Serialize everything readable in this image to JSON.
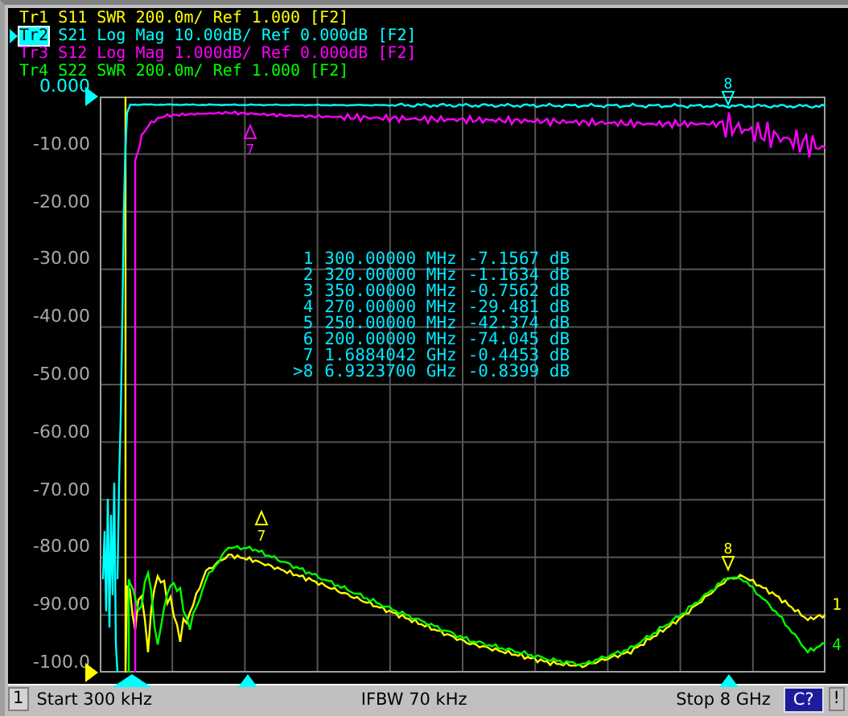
{
  "traces": [
    {
      "name": "Tr1",
      "param": "S11",
      "format": "SWR",
      "scale": "200.0m/",
      "ref": "Ref 1.000",
      "channel": "[F2]",
      "color": "#ffff00",
      "selected": false,
      "end_tag": "1"
    },
    {
      "name": "Tr2",
      "param": "S21",
      "format": "Log Mag",
      "scale": "10.00dB/",
      "ref": "Ref 0.000dB",
      "channel": "[F2]",
      "color": "#00ffff",
      "selected": true
    },
    {
      "name": "Tr3",
      "param": "S12",
      "format": "Log Mag",
      "scale": "1.000dB/",
      "ref": "Ref 0.000dB",
      "channel": "[F2]",
      "color": "#ff00ff",
      "selected": false
    },
    {
      "name": "Tr4",
      "param": "S22",
      "format": "SWR",
      "scale": "200.0m/",
      "ref": "Ref 1.000",
      "channel": "[F2]",
      "color": "#00ff00",
      "selected": false,
      "end_tag": "4"
    }
  ],
  "y_axis_labels": [
    {
      "text": "0.000",
      "reference": true
    },
    {
      "text": "-10.00",
      "reference": false
    },
    {
      "text": "-20.00",
      "reference": false
    },
    {
      "text": "-30.00",
      "reference": false
    },
    {
      "text": "-40.00",
      "reference": false
    },
    {
      "text": "-50.00",
      "reference": false
    },
    {
      "text": "-60.00",
      "reference": false
    },
    {
      "text": "-70.00",
      "reference": false
    },
    {
      "text": "-80.00",
      "reference": false
    },
    {
      "text": "-90.00",
      "reference": false
    },
    {
      "text": "-100.0",
      "reference": false
    }
  ],
  "flags": [
    {
      "label": "8",
      "color": "#00ffff"
    },
    {
      "label": "7",
      "color": "#ff00ff"
    },
    {
      "label": "7",
      "color": "#ffff00"
    },
    {
      "label": "8",
      "color": "#ffff00"
    }
  ],
  "markers": [
    {
      "label": "1",
      "stimulus": "300.00000 MHz",
      "response": "-7.1567 dB"
    },
    {
      "label": "2",
      "stimulus": "320.00000 MHz",
      "response": "-1.1634 dB"
    },
    {
      "label": "3",
      "stimulus": "350.00000 MHz",
      "response": "-0.7562 dB"
    },
    {
      "label": "4",
      "stimulus": "270.00000 MHz",
      "response": "-29.481 dB"
    },
    {
      "label": "5",
      "stimulus": "250.00000 MHz",
      "response": "-42.374 dB"
    },
    {
      "label": "6",
      "stimulus": "200.00000 MHz",
      "response": "-74.045 dB"
    },
    {
      "label": "7",
      "stimulus": "1.6884042 GHz",
      "response": "-0.4453 dB"
    },
    {
      "label": ">8",
      "stimulus": "6.9323700 GHz",
      "response": "-0.8399 dB"
    }
  ],
  "status_bar": {
    "channel": "1",
    "start": "Start 300 kHz",
    "ifbw": "IFBW 70 kHz",
    "stop": "Stop 8 GHz",
    "calibration": "C?",
    "warning": "!"
  }
}
